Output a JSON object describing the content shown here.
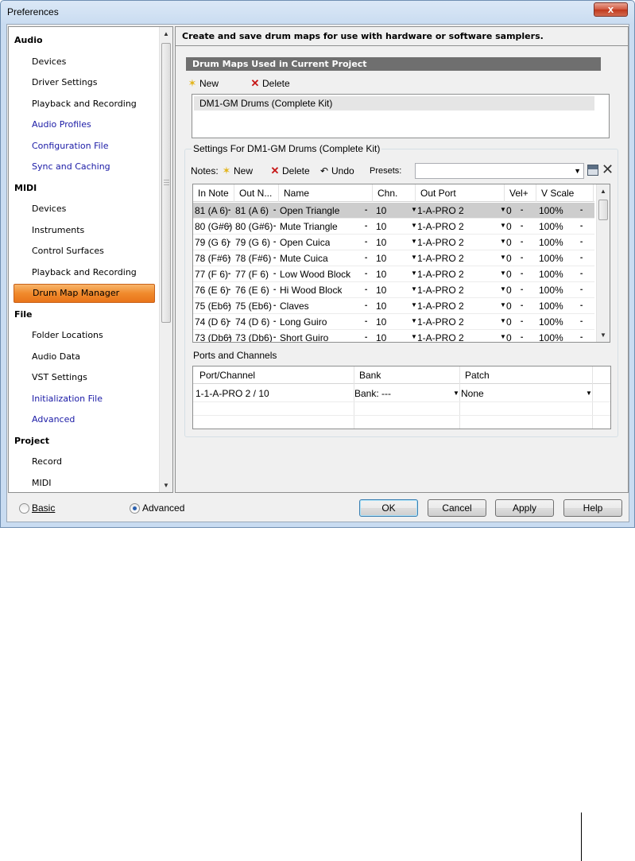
{
  "window": {
    "title": "Preferences",
    "close_label": "x"
  },
  "nav": {
    "items": [
      {
        "label": "Audio",
        "kind": "group"
      },
      {
        "label": "Devices",
        "kind": "sub"
      },
      {
        "label": "Driver Settings",
        "kind": "sub"
      },
      {
        "label": "Playback and Recording",
        "kind": "sub"
      },
      {
        "label": "Audio Profiles",
        "kind": "link"
      },
      {
        "label": "Configuration File",
        "kind": "link"
      },
      {
        "label": "Sync and Caching",
        "kind": "link"
      },
      {
        "label": "MIDI",
        "kind": "group"
      },
      {
        "label": "Devices",
        "kind": "sub"
      },
      {
        "label": "Instruments",
        "kind": "sub"
      },
      {
        "label": "Control Surfaces",
        "kind": "sub"
      },
      {
        "label": "Playback and Recording",
        "kind": "sub"
      },
      {
        "label": "Drum Map Manager",
        "kind": "selected"
      },
      {
        "label": "File",
        "kind": "group"
      },
      {
        "label": "Folder Locations",
        "kind": "sub"
      },
      {
        "label": "Audio Data",
        "kind": "sub"
      },
      {
        "label": "VST Settings",
        "kind": "sub"
      },
      {
        "label": "Initialization File",
        "kind": "link"
      },
      {
        "label": "Advanced",
        "kind": "link"
      },
      {
        "label": "Project",
        "kind": "group"
      },
      {
        "label": "Record",
        "kind": "sub"
      },
      {
        "label": "MIDI",
        "kind": "sub"
      }
    ]
  },
  "content": {
    "description": "Create and save drum maps for use with hardware or software samplers.",
    "maps_header": "Drum Maps Used in Current Project",
    "maps_toolbar": {
      "new_label": "New",
      "delete_label": "Delete"
    },
    "maps": [
      "DM1-GM Drums (Complete Kit)"
    ],
    "settings_title": "Settings For DM1-GM Drums (Complete Kit)",
    "notes_toolbar": {
      "notes_label": "Notes:",
      "new_label": "New",
      "delete_label": "Delete",
      "undo_label": "Undo",
      "presets_label": "Presets:",
      "presets_value": ""
    },
    "notes_grid": {
      "columns": [
        "In Note",
        "Out N...",
        "Name",
        "Chn.",
        "Out Port",
        "Vel+",
        "V Scale"
      ],
      "rows": [
        {
          "in": "81 (A 6)",
          "out": "81 (A 6)",
          "name": "Open Triangle",
          "chn": "10",
          "port": "1-A-PRO 2",
          "vel": "0",
          "vscale": "100%",
          "selected": true
        },
        {
          "in": "80 (G#6)",
          "out": "80 (G#6)",
          "name": "Mute Triangle",
          "chn": "10",
          "port": "1-A-PRO 2",
          "vel": "0",
          "vscale": "100%"
        },
        {
          "in": "79 (G 6)",
          "out": "79 (G 6)",
          "name": "Open Cuica",
          "chn": "10",
          "port": "1-A-PRO 2",
          "vel": "0",
          "vscale": "100%"
        },
        {
          "in": "78 (F#6)",
          "out": "78 (F#6)",
          "name": "Mute Cuica",
          "chn": "10",
          "port": "1-A-PRO 2",
          "vel": "0",
          "vscale": "100%"
        },
        {
          "in": "77 (F 6)",
          "out": "77 (F 6)",
          "name": "Low Wood Block",
          "chn": "10",
          "port": "1-A-PRO 2",
          "vel": "0",
          "vscale": "100%"
        },
        {
          "in": "76 (E 6)",
          "out": "76 (E 6)",
          "name": "Hi Wood Block",
          "chn": "10",
          "port": "1-A-PRO 2",
          "vel": "0",
          "vscale": "100%"
        },
        {
          "in": "75 (Eb6)",
          "out": "75 (Eb6)",
          "name": "Claves",
          "chn": "10",
          "port": "1-A-PRO 2",
          "vel": "0",
          "vscale": "100%"
        },
        {
          "in": "74 (D 6)",
          "out": "74 (D 6)",
          "name": "Long Guiro",
          "chn": "10",
          "port": "1-A-PRO 2",
          "vel": "0",
          "vscale": "100%"
        },
        {
          "in": "73 (Db6)",
          "out": "73 (Db6)",
          "name": "Short Guiro",
          "chn": "10",
          "port": "1-A-PRO 2",
          "vel": "0",
          "vscale": "100%"
        }
      ]
    },
    "ports": {
      "label": "Ports and Channels",
      "columns": [
        "Port/Channel",
        "Bank",
        "Patch"
      ],
      "rows": [
        {
          "port": "1-1-A-PRO 2 / 10",
          "bank": "Bank: ---",
          "patch": "None"
        }
      ]
    }
  },
  "footer": {
    "basic_label": "Basic",
    "advanced_label": "Advanced",
    "ok_label": "OK",
    "cancel_label": "Cancel",
    "apply_label": "Apply",
    "help_label": "Help"
  },
  "colors": {
    "selected_nav": "#f08a2c",
    "link_text": "#1a1aa6",
    "section_header": "#6f6f6f"
  }
}
